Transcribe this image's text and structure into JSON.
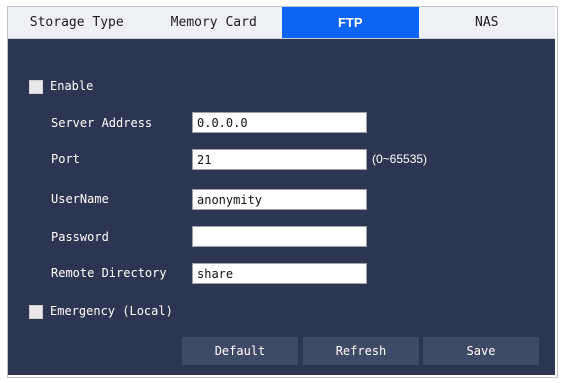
{
  "tabs": [
    {
      "label": "Storage Type",
      "active": false
    },
    {
      "label": "Memory Card",
      "active": false
    },
    {
      "label": "FTP",
      "active": true
    },
    {
      "label": "NAS",
      "active": false
    }
  ],
  "form": {
    "enable_label": "Enable",
    "enable_checked": false,
    "server_address_label": "Server Address",
    "server_address_value": "0.0.0.0",
    "port_label": "Port",
    "port_value": "21",
    "port_hint": "(0~65535)",
    "username_label": "UserName",
    "username_value": "anonymity",
    "password_label": "Password",
    "password_value": "",
    "remote_directory_label": "Remote Directory",
    "remote_directory_value": "share",
    "emergency_label": "Emergency (Local)",
    "emergency_checked": false
  },
  "buttons": {
    "default_label": "Default",
    "refresh_label": "Refresh",
    "save_label": "Save"
  },
  "colors": {
    "panel_bg": "#2c3653",
    "active_tab": "#0d64f2",
    "button_bg": "#3f4a66"
  }
}
